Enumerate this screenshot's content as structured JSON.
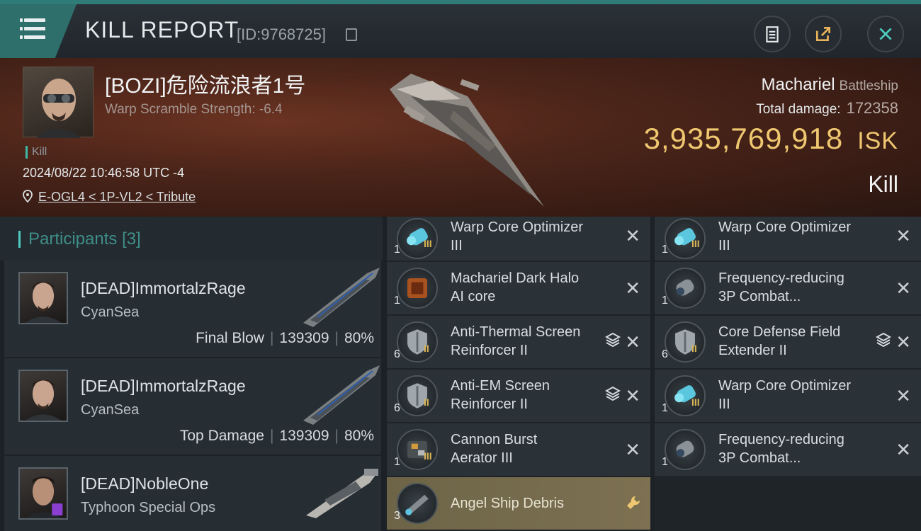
{
  "header": {
    "title": "KILL REPORT",
    "report_id": "[ID:9768725]"
  },
  "victim": {
    "name": "[BOZI]危险流浪者1号",
    "scramble": "Warp Scramble Strength: -6.4",
    "tag": "Kill",
    "datetime": "2024/08/22 10:46:58 UTC -4",
    "location": "E-OGL4 < 1P-VL2 < Tribute",
    "ship": "Machariel",
    "ship_class": "Battleship",
    "total_damage_label": "Total damage:",
    "total_damage": "172358",
    "isk_value": "3,935,769,918",
    "isk_unit": "ISK",
    "result": "Kill"
  },
  "participants": {
    "label": "Participants",
    "count": "[3]",
    "list": [
      {
        "name": "[DEAD]ImmortalzRage",
        "corp": "CyanSea",
        "role": "Final Blow",
        "damage": "139309",
        "percent": "80%"
      },
      {
        "name": "[DEAD]ImmortalzRage",
        "corp": "CyanSea",
        "role": "Top Damage",
        "damage": "139309",
        "percent": "80%"
      },
      {
        "name": "[DEAD]NobleOne",
        "corp": "Typhoon Special Ops"
      }
    ]
  },
  "modules_left": [
    {
      "qty": "1",
      "tier": "III",
      "line1": "Warp Core Optimizer",
      "line2": "III"
    },
    {
      "qty": "1",
      "tier": "",
      "line1": "Machariel Dark Halo",
      "line2": "AI core"
    },
    {
      "qty": "6",
      "tier": "II",
      "line1": "Anti-Thermal Screen",
      "line2": "Reinforcer II"
    },
    {
      "qty": "6",
      "tier": "II",
      "line1": "Anti-EM Screen",
      "line2": "Reinforcer II"
    },
    {
      "qty": "1",
      "tier": "III",
      "line1": "Cannon Burst",
      "line2": "Aerator III"
    },
    {
      "qty": "3",
      "tier": "",
      "line1": "Angel Ship Debris",
      "line2": ""
    }
  ],
  "modules_right": [
    {
      "qty": "1",
      "tier": "III",
      "line1": "Warp Core Optimizer",
      "line2": "III"
    },
    {
      "qty": "1",
      "tier": "",
      "line1": "Frequency-reducing",
      "line2": "3P Combat..."
    },
    {
      "qty": "6",
      "tier": "II",
      "line1": "Core Defense Field",
      "line2": "Extender II"
    },
    {
      "qty": "1",
      "tier": "III",
      "line1": "Warp Core Optimizer",
      "line2": "III"
    },
    {
      "qty": "1",
      "tier": "",
      "line1": "Frequency-reducing",
      "line2": "3P Combat..."
    }
  ],
  "icons": {
    "close": "x-icon",
    "stack": "layers-icon",
    "wrench": "wrench-icon"
  },
  "colors": {
    "accent": "#2f7b77",
    "isk": "#efc770",
    "highlight": "#7d7152"
  }
}
